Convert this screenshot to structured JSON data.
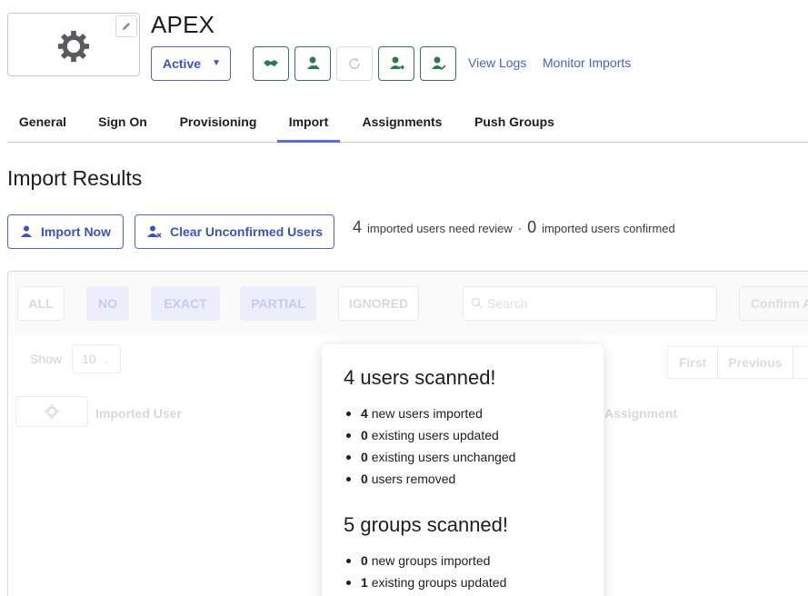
{
  "app": {
    "title": "APEX",
    "status": "Active",
    "links": {
      "view_logs": "View Logs",
      "monitor_imports": "Monitor Imports"
    }
  },
  "tabs": [
    {
      "label": "General"
    },
    {
      "label": "Sign On"
    },
    {
      "label": "Provisioning"
    },
    {
      "label": "Import",
      "active": true
    },
    {
      "label": "Assignments"
    },
    {
      "label": "Push Groups"
    }
  ],
  "section": {
    "title": "Import Results",
    "import_now": "Import Now",
    "clear_unconfirmed": "Clear Unconfirmed Users",
    "review_count": "4",
    "review_text": "imported users need review",
    "separator": "·",
    "confirmed_count": "0",
    "confirmed_text": "imported users confirmed"
  },
  "filters": [
    "ALL",
    "NO",
    "EXACT",
    "PARTIAL",
    "IGNORED"
  ],
  "search": {
    "placeholder": "Search"
  },
  "confirm_button": "Confirm A",
  "table": {
    "show_label": "Show",
    "page_size": "10",
    "pager": {
      "first": "First",
      "previous": "Previous"
    },
    "columns": {
      "imported_user": "Imported User",
      "assignment": "Assignment"
    }
  },
  "modal": {
    "users_title": "4 users scanned!",
    "users": [
      {
        "count": "4",
        "text": "new users imported"
      },
      {
        "count": "0",
        "text": "existing users updated"
      },
      {
        "count": "0",
        "text": "existing users unchanged"
      },
      {
        "count": "0",
        "text": "users removed"
      }
    ],
    "groups_title": "5 groups scanned!",
    "groups": [
      {
        "count": "0",
        "text": "new groups imported"
      },
      {
        "count": "1",
        "text": "existing groups updated"
      }
    ]
  },
  "colors": {
    "accent": "#4b61c9",
    "action_green": "#2d7a4f",
    "text": "#1d1d21"
  }
}
